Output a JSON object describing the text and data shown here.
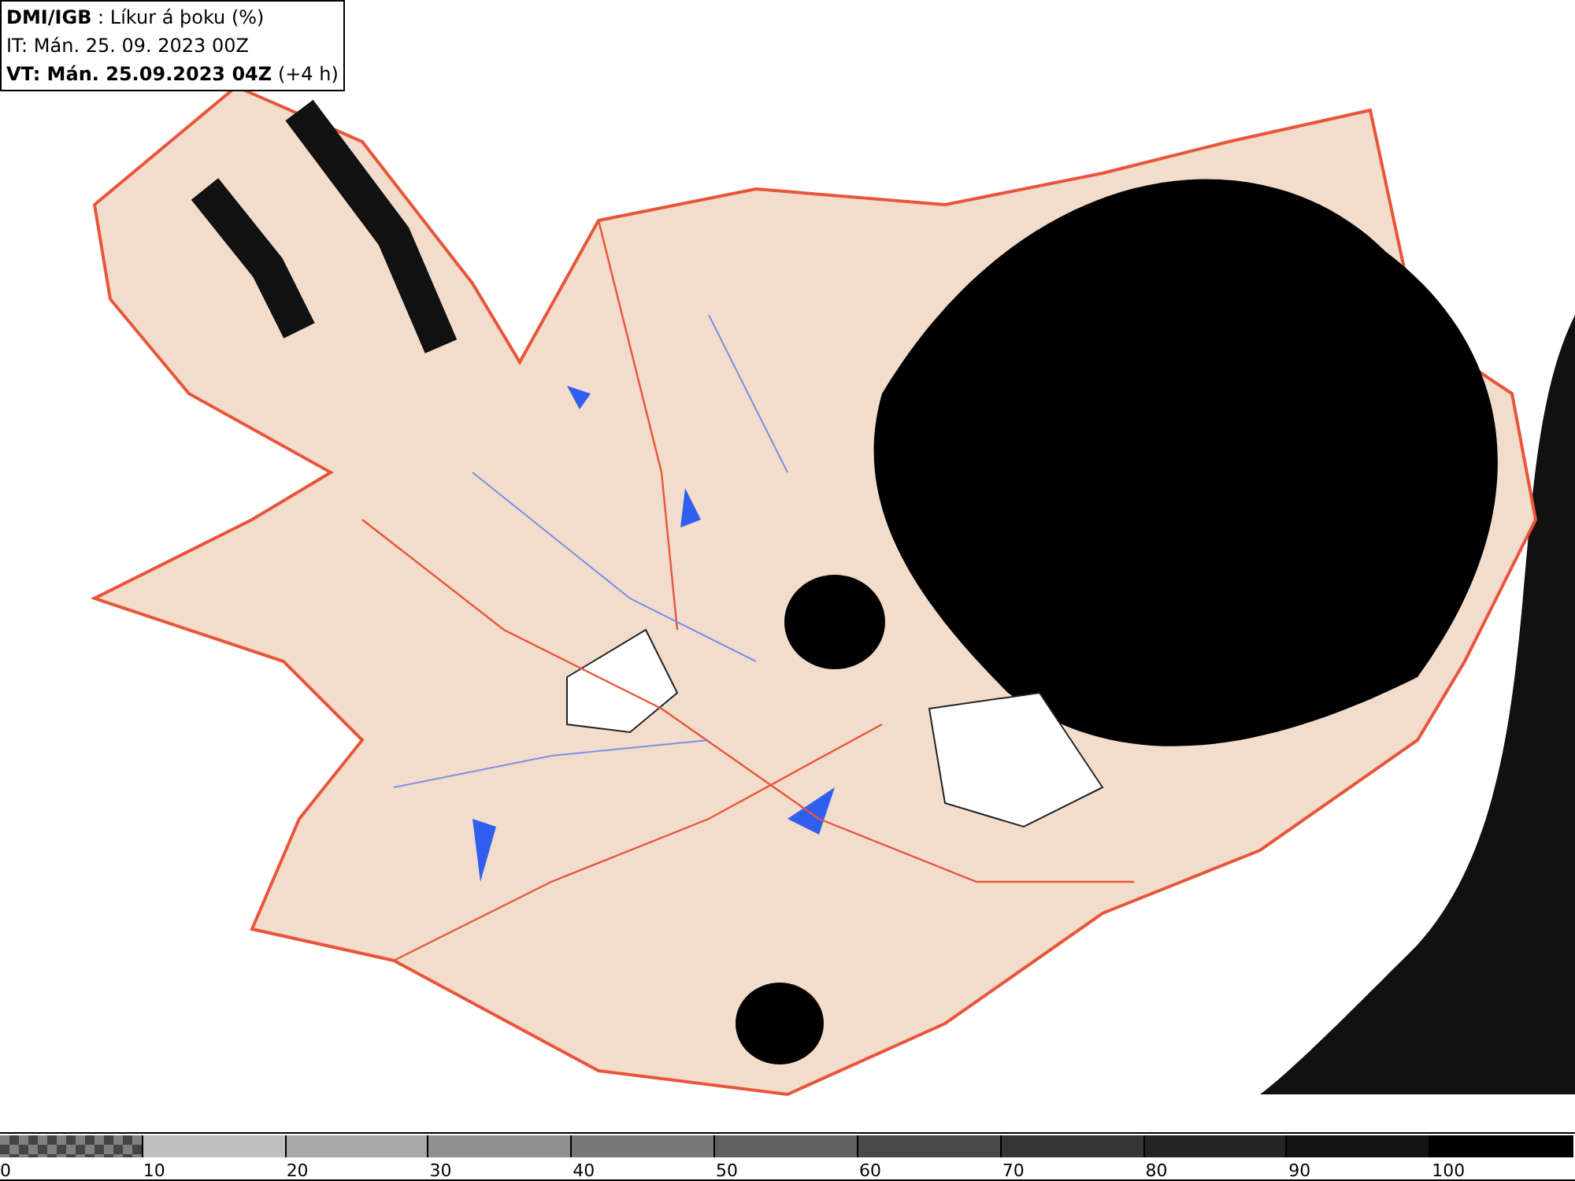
{
  "header": {
    "source": "DMI/IGB",
    "title": " : Líkur á þoku (%)",
    "issue_time": "IT: Mán. 25. 09. 2023 00Z",
    "valid_time": "VT: Mán. 25.09.2023 04Z",
    "lead": "(+4 h)"
  },
  "legend": {
    "segments": [
      {
        "kind": "checker",
        "color": "#808080"
      },
      {
        "kind": "solid",
        "color": "#c0c0c0"
      },
      {
        "kind": "solid",
        "color": "#a8a8a8"
      },
      {
        "kind": "solid",
        "color": "#909090"
      },
      {
        "kind": "solid",
        "color": "#787878"
      },
      {
        "kind": "solid",
        "color": "#606060"
      },
      {
        "kind": "solid",
        "color": "#484848"
      },
      {
        "kind": "solid",
        "color": "#363636"
      },
      {
        "kind": "solid",
        "color": "#242424"
      },
      {
        "kind": "solid",
        "color": "#141414"
      },
      {
        "kind": "solid",
        "color": "#000000"
      }
    ],
    "labels": [
      "0",
      "10",
      "20",
      "30",
      "40",
      "50",
      "60",
      "70",
      "80",
      "90",
      "100"
    ]
  }
}
